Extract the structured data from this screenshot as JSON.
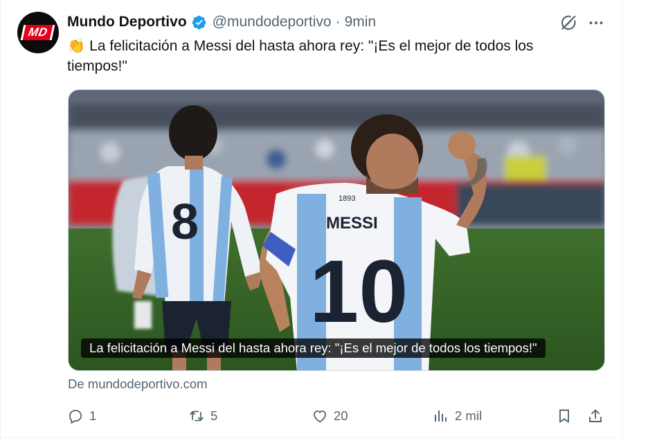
{
  "tweet": {
    "avatar_text": "MD",
    "display_name": "Mundo Deportivo",
    "handle": "@mundodeportivo",
    "separator": "·",
    "time": "9min",
    "emoji": "👏",
    "text": "La felicitación a Messi del hasta ahora rey: \"¡Es el mejor de todos los tiempos!\"",
    "card": {
      "caption": "La felicitación a Messi del hasta ahora rey: \"¡Es el mejor de todos los tiempos!\"",
      "jersey_name": "MESSI",
      "jersey_number": "10",
      "back_number": "8",
      "badge_year": "1893"
    },
    "source": "De mundodeportivo.com"
  },
  "actions": {
    "replies": "1",
    "reposts": "5",
    "likes": "20",
    "views": "2 mil"
  },
  "colors": {
    "verified": "#1d9bf0",
    "secondary_text": "#536471",
    "brand_red": "#e3001b"
  },
  "icons": [
    "verified-badge-icon",
    "grok-icon",
    "more-icon",
    "reply-icon",
    "repost-icon",
    "like-icon",
    "views-icon",
    "bookmark-icon",
    "share-icon"
  ]
}
